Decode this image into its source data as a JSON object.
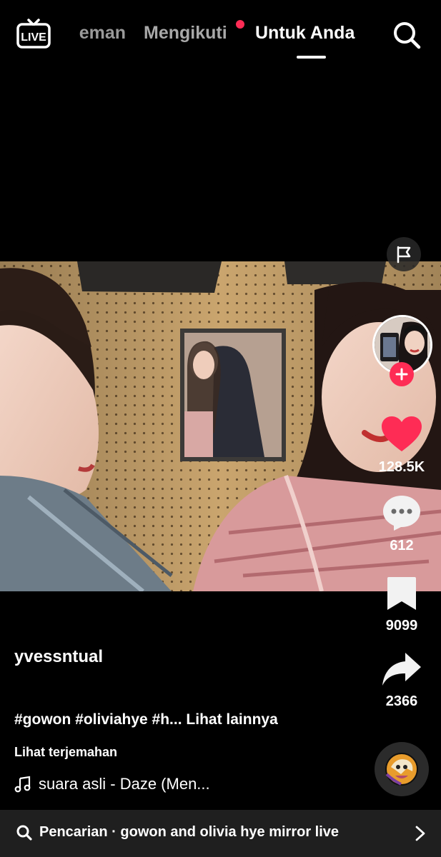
{
  "header": {
    "live_label": "LIVE",
    "tabs": [
      {
        "label": "Teman",
        "visible_text": "eman"
      },
      {
        "label": "Mengikuti"
      },
      {
        "label": "Untuk Anda"
      }
    ],
    "active_tab": "Untuk Anda",
    "icons": {
      "live": "live-tv-icon",
      "search": "search-icon"
    }
  },
  "actions": {
    "likes": "128.5K",
    "comments": "612",
    "bookmarks": "9099",
    "shares": "2366",
    "icons": [
      "report-flag-icon",
      "heart-icon",
      "comment-icon",
      "bookmark-icon",
      "share-icon",
      "music-disc-icon"
    ]
  },
  "post": {
    "username": "yvessntual",
    "hashtags": "#gowon #oliviahye #h...",
    "see_more": "Lihat lainnya",
    "translate": "Lihat terjemahan",
    "music": "suara asli - Daze (Men..."
  },
  "bottom_bar": {
    "label": "Pencarian",
    "separator": "·",
    "query": "gowon and olivia hye mirror live"
  },
  "colors": {
    "accent": "#fe2c55",
    "background": "#000000",
    "inactive_tab": "#a8a8a8",
    "bar": "#1f1f1f"
  }
}
